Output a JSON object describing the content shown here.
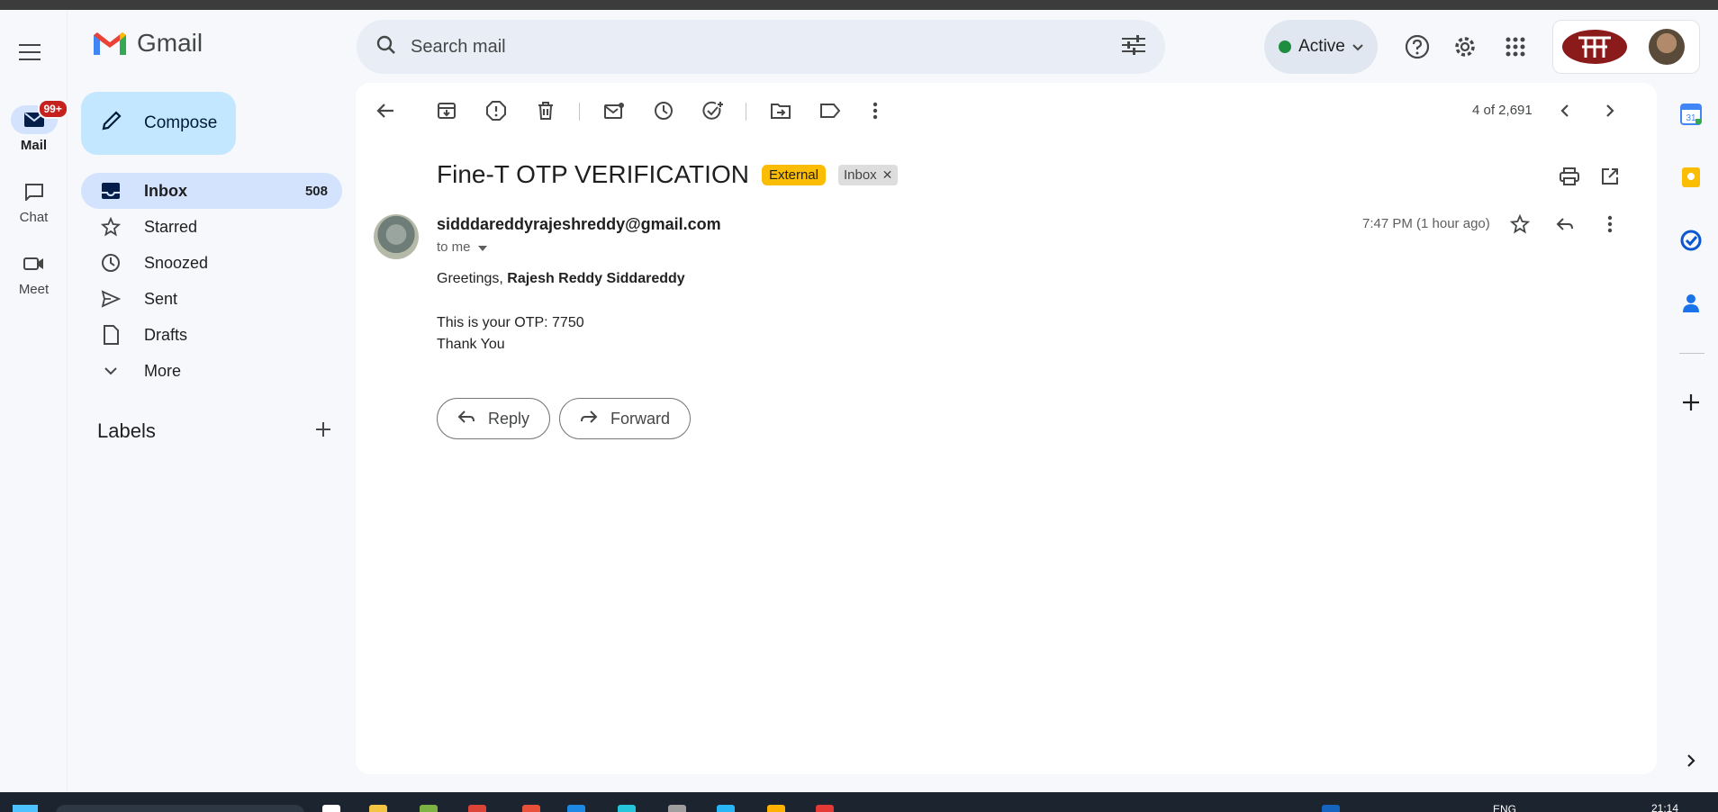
{
  "app": {
    "name": "Gmail"
  },
  "rail": {
    "mail_label": "Mail",
    "mail_badge": "99+",
    "chat_label": "Chat",
    "meet_label": "Meet"
  },
  "search": {
    "placeholder": "Search mail"
  },
  "status": {
    "label": "Active"
  },
  "compose_label": "Compose",
  "nav": {
    "inbox": "Inbox",
    "inbox_count": "508",
    "starred": "Starred",
    "snoozed": "Snoozed",
    "sent": "Sent",
    "drafts": "Drafts",
    "more": "More"
  },
  "labels_title": "Labels",
  "pager": "4 of 2,691",
  "email": {
    "subject": "Fine-T OTP VERIFICATION",
    "tag_external": "External",
    "tag_inbox": "Inbox",
    "sender": "sidddareddyrajeshreddy@gmail.com",
    "to": "to me",
    "time": "7:47 PM (1 hour ago)",
    "greeting_prefix": "Greetings, ",
    "greeting_name": "Rajesh Reddy Siddareddy",
    "otp_line": "This is your OTP: 7750",
    "signoff": "Thank You"
  },
  "actions": {
    "reply": "Reply",
    "forward": "Forward"
  },
  "side": {
    "calendar_day": "31"
  },
  "taskbar": {
    "lang": "ENG",
    "clock": "21:14"
  },
  "colors": {
    "accent": "#0b57d0",
    "compose_bg": "#c2e7ff",
    "selected_bg": "#d3e3fd",
    "external_tag": "#fbbc04",
    "badge": "#c5221f"
  }
}
